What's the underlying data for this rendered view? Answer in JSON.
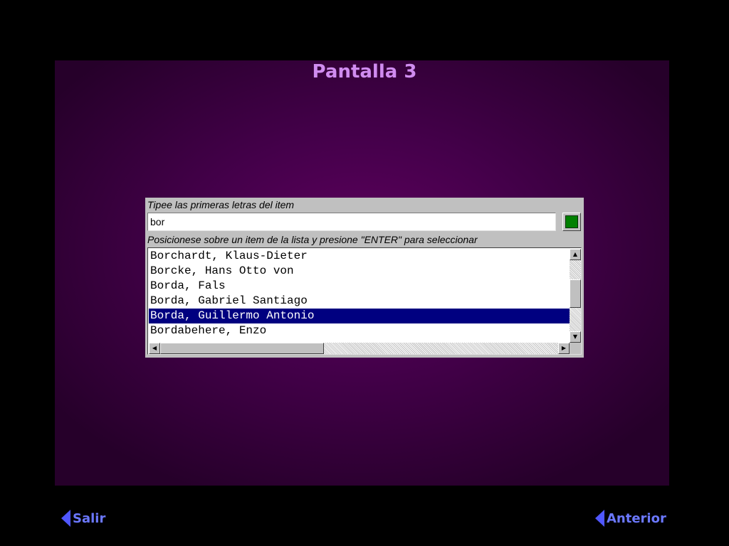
{
  "screen": {
    "title": "Pantalla 3"
  },
  "dialog": {
    "input_label": "Tipee las primeras letras del item",
    "input_value": "bor",
    "list_label": "Posicionese sobre un item de la lista y presione \"ENTER\" para seleccionar",
    "items": [
      "Borchardt, Klaus-Dieter",
      "Borcke, Hans Otto von",
      "Borda, Fals",
      "Borda, Gabriel Santiago",
      "Borda, Guillermo Antonio",
      "Bordabehere, Enzo"
    ],
    "selected_index": 4,
    "vscroll_position": 0.45,
    "hscroll_position": 0.0
  },
  "nav": {
    "left_label": "Salir",
    "right_label": "Anterior"
  },
  "colors": {
    "accent": "#5057ff",
    "title": "#d08cf0",
    "selection": "#000080",
    "ok": "#008000"
  },
  "icons": {
    "nav_left": "triangle-left-icon",
    "nav_right": "triangle-left-icon"
  }
}
